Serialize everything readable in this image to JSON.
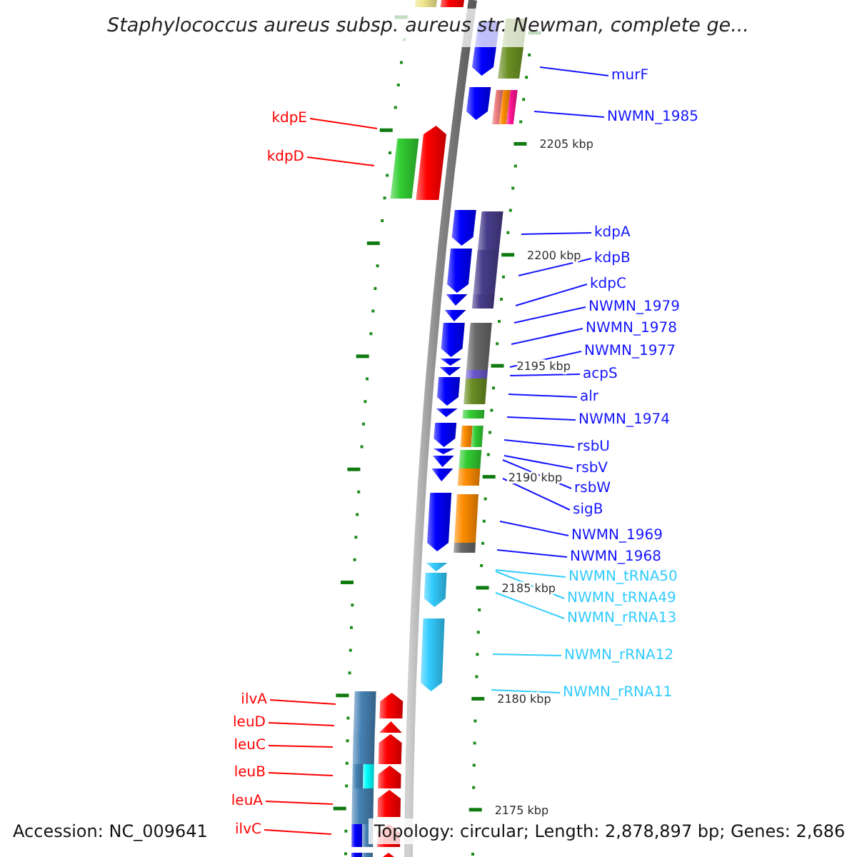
{
  "title": "Staphylococcus aureus subsp. aureus str. Newman, complete ge...",
  "map": {
    "scale_labels": [
      "2205 kbp",
      "2200 kbp",
      "2195 kbp",
      "2190 kbp",
      "2185 kbp",
      "2180 kbp",
      "2175 kbp"
    ],
    "right_labels": [
      {
        "text": "murF",
        "color": "#1414ff"
      },
      {
        "text": "NWMN_1985",
        "color": "#1414ff"
      },
      {
        "text": "kdpA",
        "color": "#1414ff"
      },
      {
        "text": "kdpB",
        "color": "#1414ff"
      },
      {
        "text": "kdpC",
        "color": "#1414ff"
      },
      {
        "text": "NWMN_1979",
        "color": "#1414ff"
      },
      {
        "text": "NWMN_1978",
        "color": "#1414ff"
      },
      {
        "text": "NWMN_1977",
        "color": "#1414ff"
      },
      {
        "text": "acpS",
        "color": "#1414ff"
      },
      {
        "text": "alr",
        "color": "#1414ff"
      },
      {
        "text": "NWMN_1974",
        "color": "#1414ff"
      },
      {
        "text": "rsbU",
        "color": "#1414ff"
      },
      {
        "text": "rsbV",
        "color": "#1414ff"
      },
      {
        "text": "rsbW",
        "color": "#1414ff"
      },
      {
        "text": "sigB",
        "color": "#1414ff"
      },
      {
        "text": "NWMN_1969",
        "color": "#1414ff"
      },
      {
        "text": "NWMN_1968",
        "color": "#1414ff"
      },
      {
        "text": "NWMN_tRNA50",
        "color": "#33ccff"
      },
      {
        "text": "NWMN_tRNA49",
        "color": "#33ccff"
      },
      {
        "text": "NWMN_rRNA13",
        "color": "#33ccff"
      },
      {
        "text": "NWMN_rRNA12",
        "color": "#33ccff"
      },
      {
        "text": "NWMN_rRNA11",
        "color": "#33ccff"
      }
    ],
    "left_labels": [
      {
        "text": "kdpE",
        "color": "#ff0000"
      },
      {
        "text": "kdpD",
        "color": "#ff0000"
      },
      {
        "text": "ilvA",
        "color": "#ff0000"
      },
      {
        "text": "leuD",
        "color": "#ff0000"
      },
      {
        "text": "leuC",
        "color": "#ff0000"
      },
      {
        "text": "leuB",
        "color": "#ff0000"
      },
      {
        "text": "leuA",
        "color": "#ff0000"
      },
      {
        "text": "ilvC",
        "color": "#ff0000"
      }
    ]
  },
  "status_bar": {
    "accession": "Accession: NC_009641",
    "summary": "Topology: circular; Length: 2,878,897 bp; Genes: 2,686"
  }
}
